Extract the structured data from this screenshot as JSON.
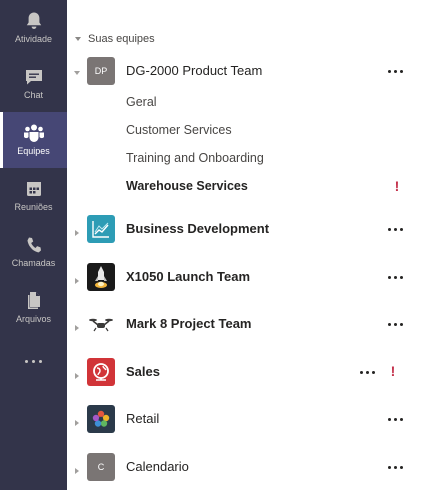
{
  "rail": {
    "items": [
      {
        "label": "Atividade",
        "icon": "bell-icon",
        "active": false
      },
      {
        "label": "Chat",
        "icon": "chat-icon",
        "active": false
      },
      {
        "label": "Equipes",
        "icon": "teams-icon",
        "active": true
      },
      {
        "label": "Reuniões",
        "icon": "calendar-icon",
        "active": false
      },
      {
        "label": "Chamadas",
        "icon": "phone-icon",
        "active": false
      },
      {
        "label": "Arquivos",
        "icon": "files-icon",
        "active": false
      }
    ],
    "more_icon": "more-apps-icon"
  },
  "section": {
    "title": "Suas equipes"
  },
  "teams": [
    {
      "name": "DG-2000 Product Team",
      "avatar_text": "DP",
      "avatar_color": "#7a7574",
      "expanded": true,
      "bold": false,
      "channels": [
        {
          "name": "Geral",
          "bold": false
        },
        {
          "name": "Customer Services",
          "bold": false
        },
        {
          "name": "Training and Onboarding",
          "bold": false
        },
        {
          "name": "Warehouse Services",
          "bold": true,
          "alert": "!"
        }
      ]
    },
    {
      "name": "Business Development",
      "avatar_icon": "chart-line-icon",
      "avatar_color": "#2d9cb5",
      "bold": true
    },
    {
      "name": "X1050 Launch Team",
      "avatar_icon": "rocket-icon",
      "avatar_color": "#1a1a1a",
      "bold": true
    },
    {
      "name": "Mark 8 Project Team",
      "avatar_icon": "drone-icon",
      "avatar_color": "#ffffff",
      "bold": true
    },
    {
      "name": "Sales",
      "avatar_icon": "globe-icon",
      "avatar_color": "#d13438",
      "bold": true,
      "alert": "!"
    },
    {
      "name": "Retail",
      "avatar_icon": "flower-icon",
      "avatar_color": "#2b3a4a",
      "bold": false
    },
    {
      "name": "Calendario",
      "avatar_text": "C",
      "avatar_color": "#7a7574",
      "bold": false
    }
  ],
  "colors": {
    "rail_bg": "#33344a",
    "rail_active": "#464775",
    "alert": "#c4314b"
  }
}
